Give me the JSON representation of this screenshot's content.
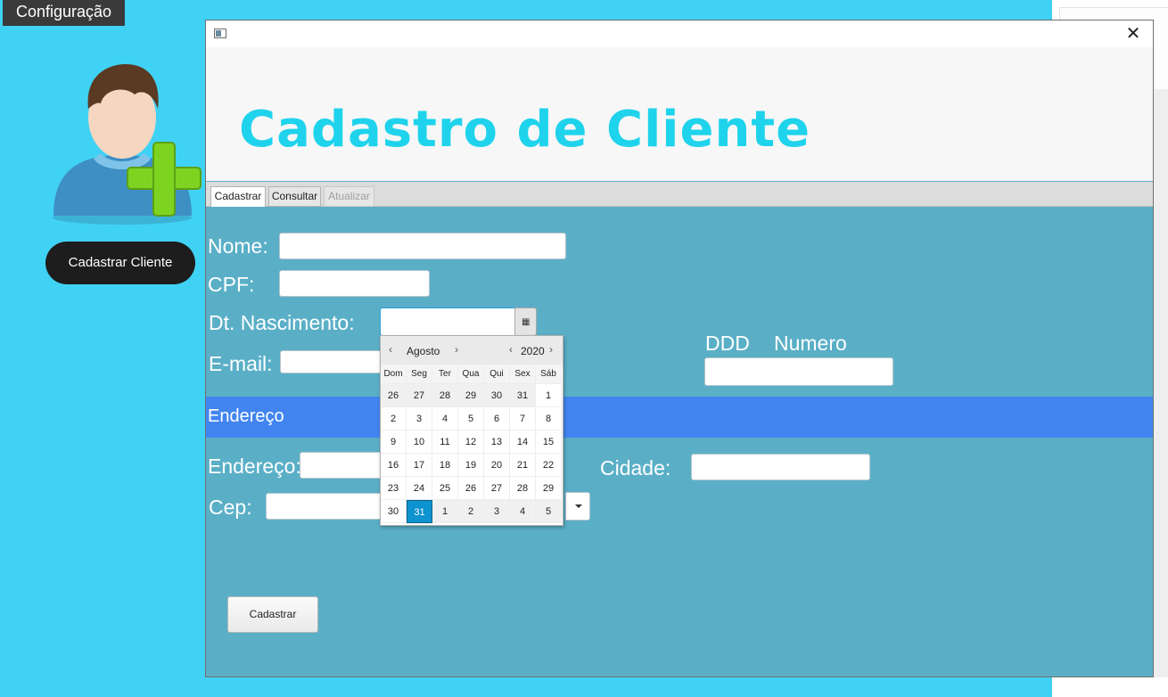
{
  "background_app": {
    "config_button": "Configuração",
    "action_button": "Cadastrar Cliente",
    "avatar_icon": "add-user-icon",
    "colors": {
      "background": "#40d2f4",
      "button_dark": "#1d1d1d"
    }
  },
  "dialog": {
    "close_glyph": "✕",
    "title": "Cadastro de Cliente",
    "tabs": [
      {
        "label": "Cadastrar",
        "state": "selected"
      },
      {
        "label": "Consultar",
        "state": "normal"
      },
      {
        "label": "Atualizar",
        "state": "disabled"
      }
    ],
    "labels": {
      "nome": "Nome:",
      "cpf": "CPF:",
      "nascimento": "Dt. Nascimento:",
      "email": "E-mail:",
      "ddd": "DDD",
      "numero": "Numero",
      "section": "Endereço",
      "endereco": "Endereço:",
      "cidade": "Cidade:",
      "cep": "Cep:"
    },
    "values": {
      "nome": "",
      "cpf": "",
      "nascimento": "",
      "email": "",
      "telefone": "",
      "endereco": "",
      "cidade": "",
      "cep": ""
    },
    "calendar_icon": "▦",
    "submit_button": "Cadastrar",
    "colors": {
      "title": "#1fd3ec",
      "panel": "#5aafc7",
      "section": "#4285f0"
    }
  },
  "date_picker": {
    "prev_glyph": "‹",
    "next_glyph": "›",
    "month": "Agosto",
    "year": "2020",
    "weekdays": [
      "Dom",
      "Seg",
      "Ter",
      "Qua",
      "Qui",
      "Sex",
      "Sáb"
    ],
    "weeks": [
      [
        "26",
        "27",
        "28",
        "29",
        "30",
        "31",
        "1"
      ],
      [
        "2",
        "3",
        "4",
        "5",
        "6",
        "7",
        "8"
      ],
      [
        "9",
        "10",
        "11",
        "12",
        "13",
        "14",
        "15"
      ],
      [
        "16",
        "17",
        "18",
        "19",
        "20",
        "21",
        "22"
      ],
      [
        "23",
        "24",
        "25",
        "26",
        "27",
        "28",
        "29"
      ],
      [
        "30",
        "31",
        "1",
        "2",
        "3",
        "4",
        "5"
      ]
    ],
    "selected_day": "31",
    "selected_color": "#0d93cf"
  }
}
